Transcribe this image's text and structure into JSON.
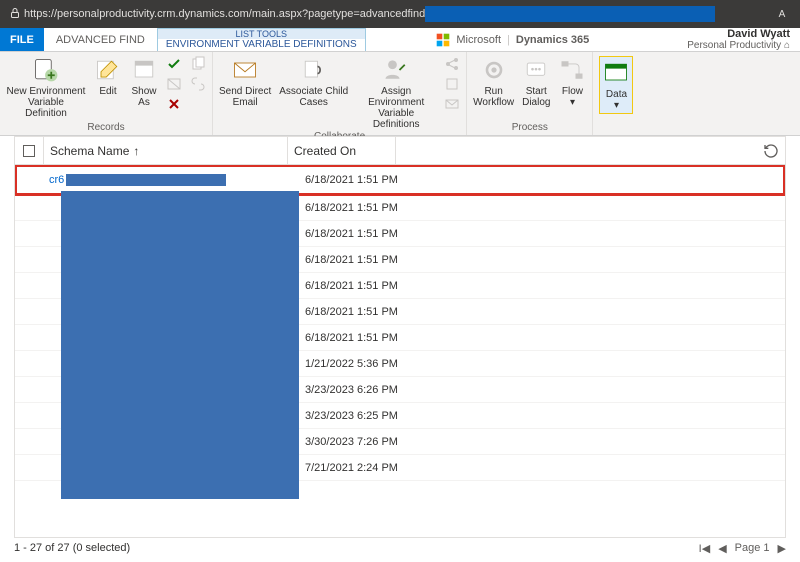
{
  "url": {
    "visible": "https://personalproductivity.crm.dynamics.com/main.aspx?pagetype=advancedfind",
    "aa": "A"
  },
  "brand": {
    "ms": "Microsoft",
    "app": "Dynamics 365"
  },
  "user": {
    "name": "David Wyatt",
    "org": "Personal Productivity"
  },
  "tabs": {
    "file": "FILE",
    "adv": "ADVANCED FIND",
    "ctx_head": "LIST TOOLS",
    "ctx_tab": "ENVIRONMENT VARIABLE DEFINITIONS"
  },
  "ribbon": {
    "new_evd": "New Environment Variable\nDefinition",
    "edit": "Edit",
    "show_as": "Show\nAs",
    "records": "Records",
    "send_email": "Send Direct\nEmail",
    "assoc_child": "Associate Child\nCases",
    "assign_evd": "Assign Environment Variable\nDefinitions",
    "collaborate": "Collaborate",
    "run_wf": "Run\nWorkflow",
    "start_dlg": "Start\nDialog",
    "flow": "Flow",
    "data": "Data",
    "process": "Process"
  },
  "grid": {
    "col_schema": "Schema Name",
    "col_created": "Created On",
    "sort_arrow": "↑",
    "first_prefix": "cr6",
    "rows": [
      "6/18/2021 1:51 PM",
      "6/18/2021 1:51 PM",
      "6/18/2021 1:51 PM",
      "6/18/2021 1:51 PM",
      "6/18/2021 1:51 PM",
      "6/18/2021 1:51 PM",
      "6/18/2021 1:51 PM",
      "1/21/2022 5:36 PM",
      "3/23/2023 6:26 PM",
      "3/23/2023 6:25 PM",
      "3/30/2023 7:26 PM",
      "7/21/2021 2:24 PM"
    ]
  },
  "pager": {
    "status": "1 - 27 of 27 (0 selected)",
    "page": "Page 1"
  }
}
